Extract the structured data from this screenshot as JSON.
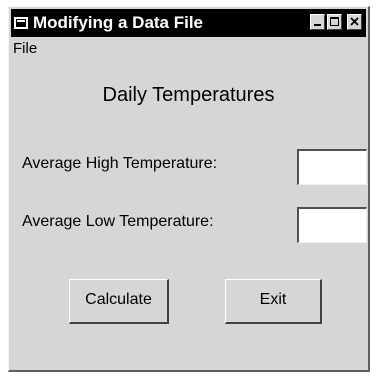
{
  "window": {
    "title": "Modifying a Data File",
    "controls": {
      "minimize": "minimize-icon",
      "maximize": "maximize-icon",
      "close": "close-icon"
    }
  },
  "menu": {
    "items": [
      {
        "label": "File"
      }
    ]
  },
  "form": {
    "heading": "Daily Temperatures",
    "high": {
      "label": "Average High Temperature:",
      "value": ""
    },
    "low": {
      "label": "Average Low Temperature:",
      "value": ""
    }
  },
  "buttons": {
    "calculate": "Calculate",
    "exit": "Exit"
  },
  "colors": {
    "face": "#d6d6d6",
    "titlebar": "#000000",
    "title_text": "#ffffff",
    "input_bg": "#ffffff"
  }
}
